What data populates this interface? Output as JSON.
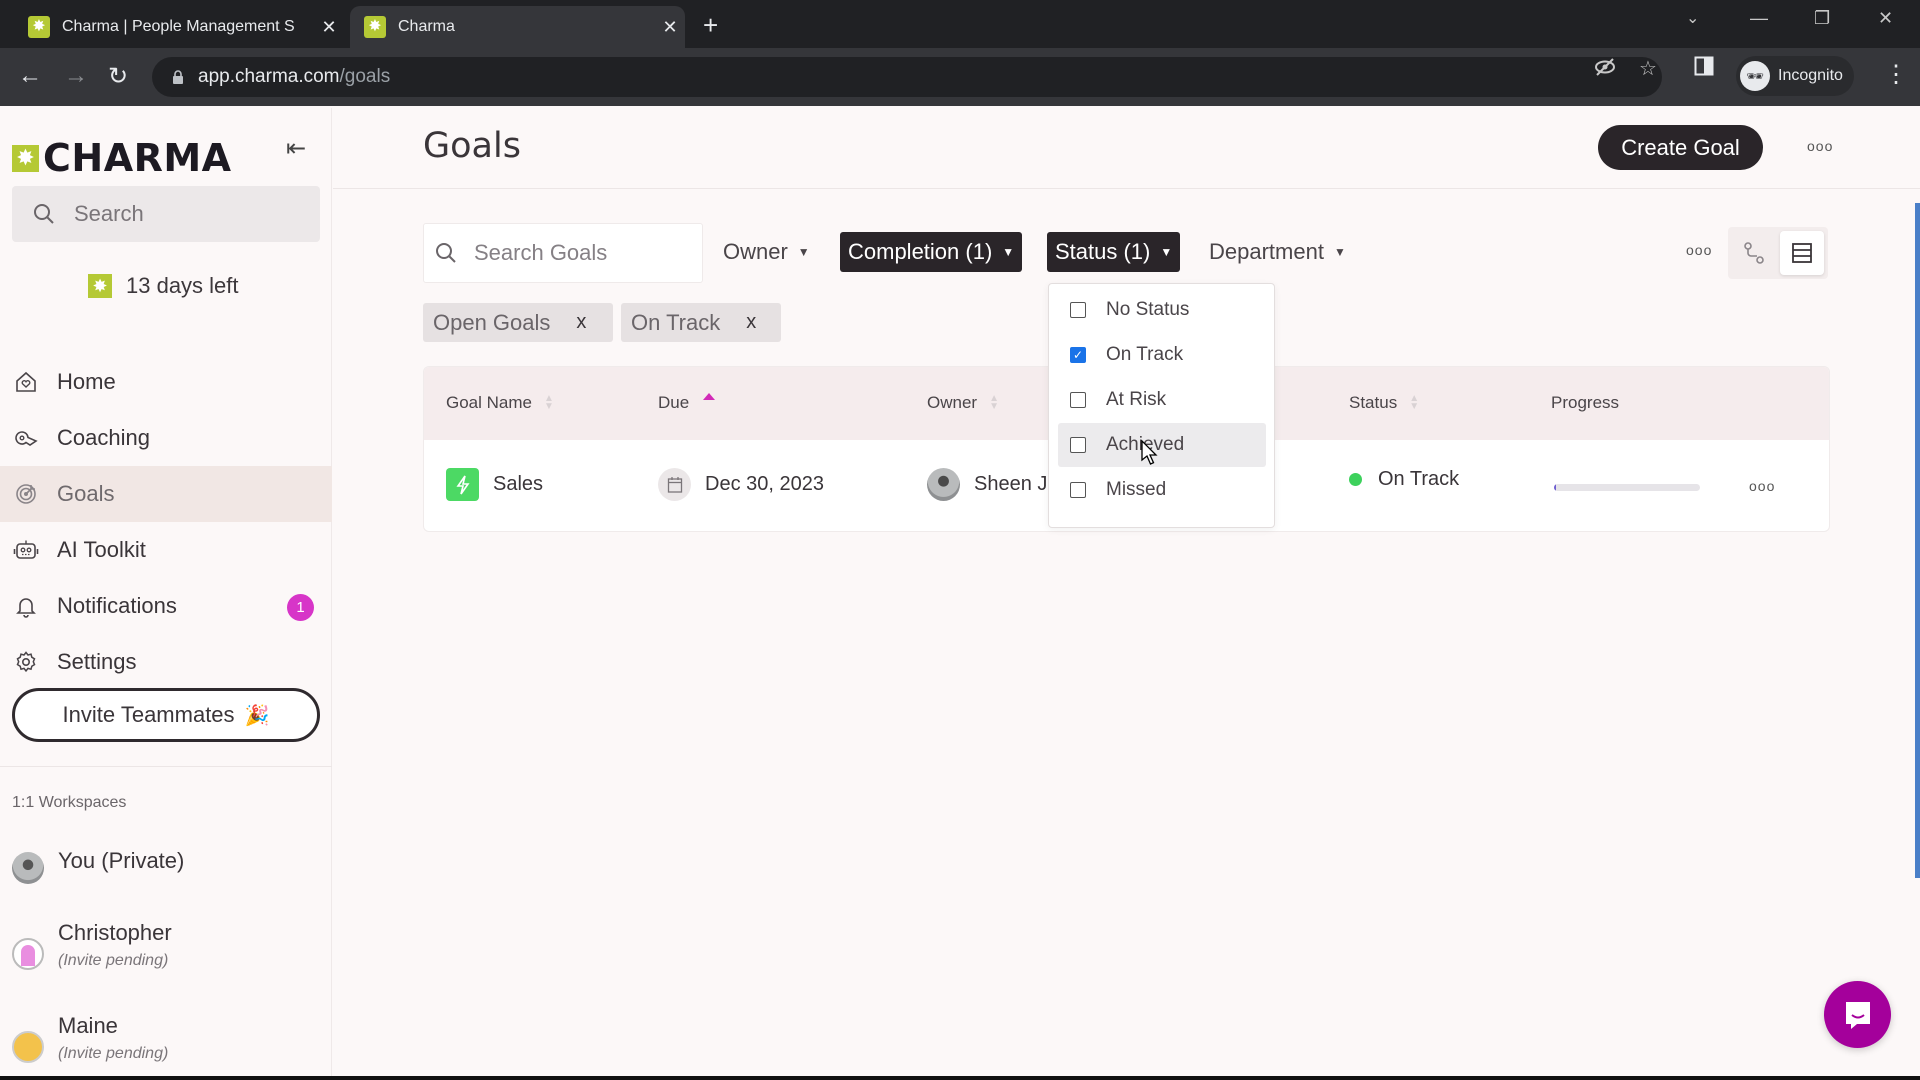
{
  "browser": {
    "tabs": [
      {
        "title": "Charma | People Management S",
        "active": false
      },
      {
        "title": "Charma",
        "active": true
      }
    ],
    "url_host": "app.charma.com",
    "url_path": "/goals",
    "profile_label": "Incognito",
    "new_tab_glyph": "+",
    "close_glyph": "✕"
  },
  "sidebar": {
    "brand": "CHARMA",
    "search_placeholder": "Search",
    "trial_text": "13 days left",
    "nav": [
      {
        "label": "Home",
        "icon": "home-heart-icon"
      },
      {
        "label": "Coaching",
        "icon": "whistle-icon"
      },
      {
        "label": "Goals",
        "icon": "target-icon",
        "active": true
      },
      {
        "label": "AI Toolkit",
        "icon": "robot-icon"
      },
      {
        "label": "Notifications",
        "icon": "bell-icon",
        "badge": "1"
      },
      {
        "label": "Settings",
        "icon": "gear-icon"
      }
    ],
    "invite_label": "Invite Teammates",
    "invite_emoji": "🎉",
    "workspaces_label": "1:1 Workspaces",
    "workspaces": [
      {
        "name": "You (Private)",
        "sub": ""
      },
      {
        "name": "Christopher",
        "sub": "(Invite pending)"
      },
      {
        "name": "Maine",
        "sub": "(Invite pending)"
      }
    ]
  },
  "header": {
    "title": "Goals",
    "create_label": "Create Goal",
    "more_glyph": "ooo"
  },
  "filters": {
    "search_placeholder": "Search Goals",
    "owner_label": "Owner",
    "completion_label": "Completion (1)",
    "status_label": "Status (1)",
    "department_label": "Department",
    "chevron": "⌄",
    "chips": [
      {
        "label": "Open Goals"
      },
      {
        "label": "On Track"
      }
    ],
    "chip_remove_glyph": "x"
  },
  "status_dropdown": {
    "options": [
      {
        "label": "No Status",
        "checked": false
      },
      {
        "label": "On Track",
        "checked": true
      },
      {
        "label": "At Risk",
        "checked": false
      },
      {
        "label": "Achieved",
        "checked": false,
        "hovered": true
      },
      {
        "label": "Missed",
        "checked": false
      }
    ]
  },
  "table": {
    "columns": [
      "Goal Name",
      "Due",
      "Owner",
      "Status",
      "Progress"
    ],
    "sorted_column": "Due",
    "sort_direction": "ascending",
    "rows": [
      {
        "goal_name": "Sales",
        "due": "Dec 30, 2023",
        "owner": "Sheen J",
        "status": "On Track",
        "status_color": "#3dd15c",
        "progress_percent": 1
      }
    ]
  },
  "colors": {
    "brand_green": "#b5c935",
    "accent_pink": "#d22ab7",
    "badge": "#d735c8",
    "chat_fab": "#a4009b",
    "dark_button": "#2a2529"
  }
}
